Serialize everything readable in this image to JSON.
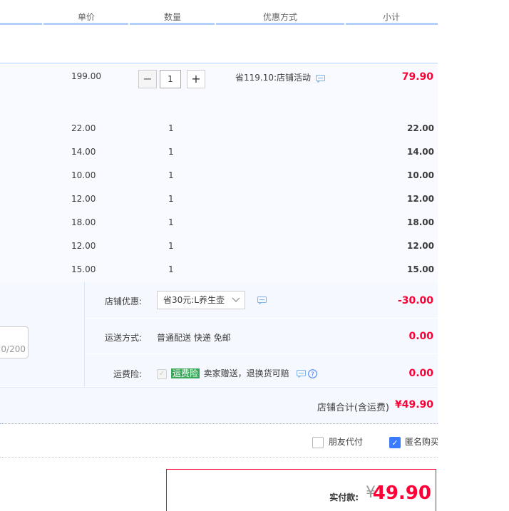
{
  "header": {
    "col_unit_price": "单价",
    "col_quantity": "数量",
    "col_discount": "优惠方式",
    "col_subtotal": "小计"
  },
  "main_item": {
    "unit_price": "199.00",
    "quantity": "1",
    "discount_text": "省119.10:店铺活动",
    "subtotal": "79.90",
    "minus_label": "−",
    "plus_label": "+"
  },
  "items": [
    {
      "unit_price": "22.00",
      "quantity": "1",
      "subtotal": "22.00"
    },
    {
      "unit_price": "14.00",
      "quantity": "1",
      "subtotal": "14.00"
    },
    {
      "unit_price": "10.00",
      "quantity": "1",
      "subtotal": "10.00"
    },
    {
      "unit_price": "12.00",
      "quantity": "1",
      "subtotal": "12.00"
    },
    {
      "unit_price": "18.00",
      "quantity": "1",
      "subtotal": "18.00"
    },
    {
      "unit_price": "12.00",
      "quantity": "1",
      "subtotal": "12.00"
    },
    {
      "unit_price": "15.00",
      "quantity": "1",
      "subtotal": "15.00"
    }
  ],
  "options": {
    "shop_discount_label": "店铺优惠:",
    "shop_discount_value": "省30元:L养生壶",
    "shop_discount_amount": "-30.00",
    "shipping_label": "运送方式:",
    "shipping_value": "普通配送 快递 免邮",
    "shipping_amount": "0.00",
    "insurance_label": "运费险:",
    "insurance_badge": "运费险",
    "insurance_text": "卖家赠送，退换货可赔",
    "insurance_amount": "0.00"
  },
  "note": {
    "counter": "0/200"
  },
  "shop_total": {
    "label": "店铺合计(含运费)",
    "amount": "¥49.90"
  },
  "payment_options": {
    "friend_pay": "朋友代付",
    "anonymous": "匿名购买",
    "anonymous_checked": true,
    "friend_pay_checked": false
  },
  "actual_payment": {
    "label": "实付款:",
    "currency": "¥",
    "amount": "49.90"
  },
  "colors": {
    "accent_blue": "#b2d1ff",
    "price_red": "#ff0036",
    "checkbox_blue": "#3b7bff",
    "insurance_green": "#39a75a"
  }
}
